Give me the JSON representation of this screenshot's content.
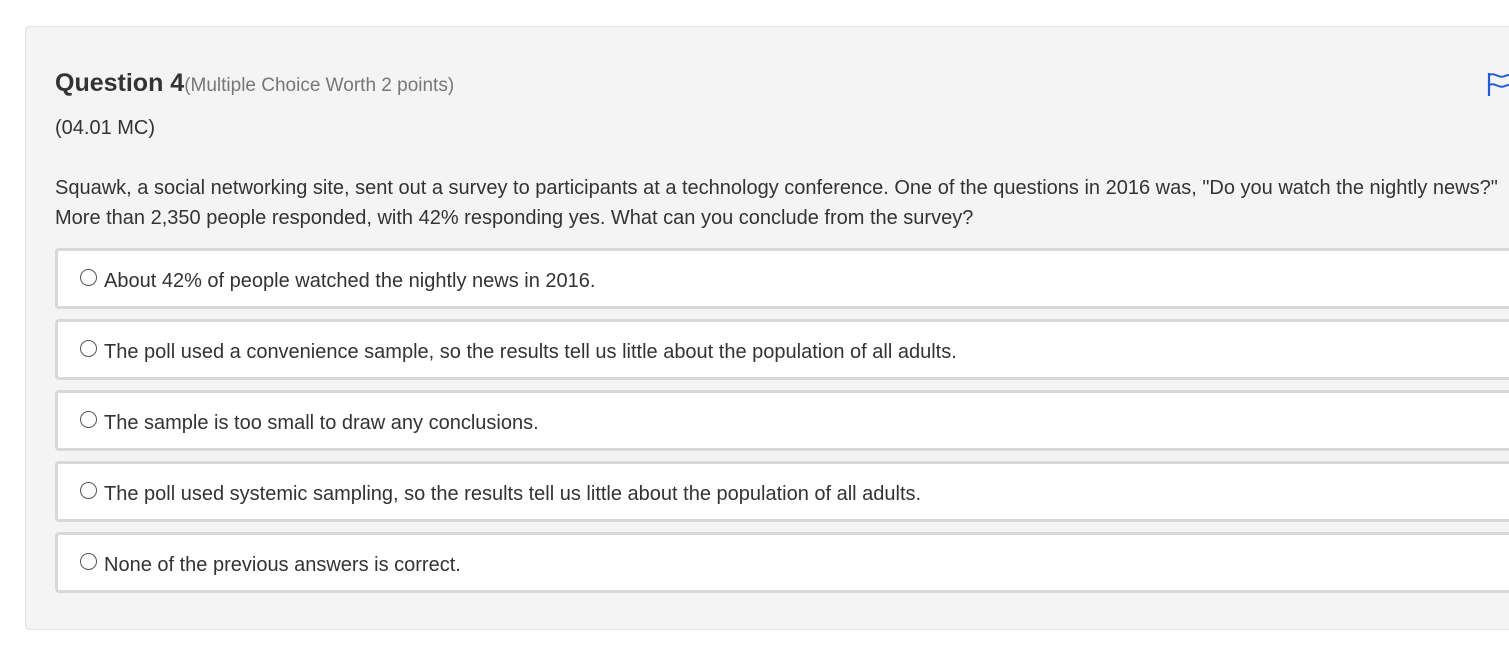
{
  "question": {
    "title": "Question 4",
    "meta": "(Multiple Choice Worth 2 points)",
    "code": "(04.01 MC)",
    "prompt": "Squawk, a social networking site, sent out a survey to participants at a technology conference. One of the questions in 2016 was, \"Do you watch the nightly news?\" More than 2,350 people responded, with 42% responding yes. What can you conclude from the survey?",
    "flag_icon": "flag-icon",
    "accent_color": "#1e5bd7"
  },
  "options": [
    {
      "label": "About 42% of people watched the nightly news in 2016."
    },
    {
      "label": "The poll used a convenience sample, so the results tell us little about the population of all adults."
    },
    {
      "label": "The sample is too small to draw any conclusions."
    },
    {
      "label": "The poll used systemic sampling, so the results tell us little about the population of all adults."
    },
    {
      "label": "None of the previous answers is correct."
    }
  ]
}
